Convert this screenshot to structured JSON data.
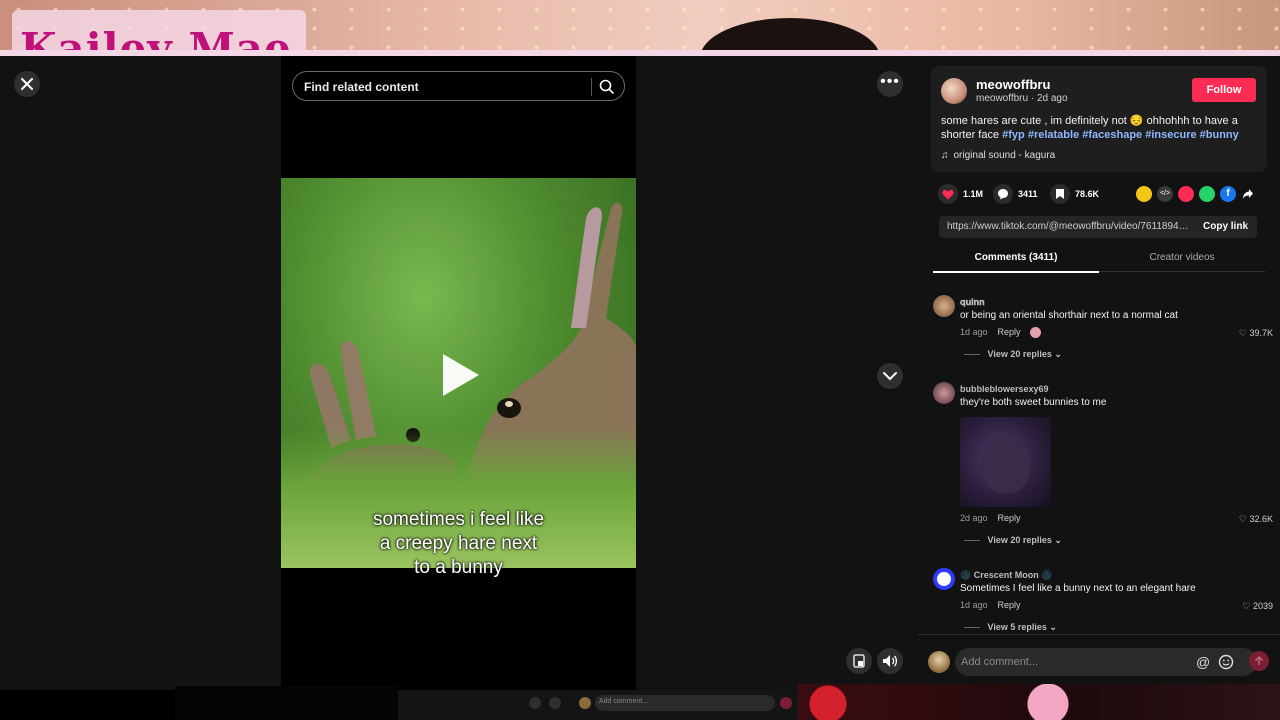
{
  "overlay": {
    "streamer_name": "Kailey Mae"
  },
  "search": {
    "placeholder": "Find related content"
  },
  "video": {
    "caption_lines": [
      "sometimes i feel like",
      "a creepy hare next",
      "to a bunny"
    ]
  },
  "author": {
    "username": "meowoffbru",
    "subline": "meowoffbru · 2d ago",
    "follow_label": "Follow",
    "description": "some hares are cute , im definitely not 😔 ohhohhh to have a shorter face",
    "hashtags": "#fyp #relatable #faceshape #insecure #bunny",
    "sound": "original sound - kagura"
  },
  "stats": {
    "likes": "1.1M",
    "comments": "3411",
    "saves": "78.6K"
  },
  "share_colors": [
    "#f5c518",
    "#3a3a3a",
    "#fe2c55",
    "#25d366",
    "#1877f2"
  ],
  "link": {
    "url": "https://www.tiktok.com/@meowoffbru/video/76118944...",
    "copy_label": "Copy link"
  },
  "tabs": {
    "comments": "Comments (3411)",
    "creator": "Creator videos"
  },
  "comments": [
    {
      "user": "𝐪𝐮𝐢𝐧𝐧",
      "text": "or being an oriental shorthair next to a normal cat",
      "time": "1d ago",
      "reply": "Reply",
      "likes": "39.7K",
      "replies": "View 20 replies"
    },
    {
      "user": "bubbleblowersexy69",
      "text": "they're both sweet bunnies to me",
      "time": "2d ago",
      "reply": "Reply",
      "likes": "32.6K",
      "replies": "View 20 replies"
    },
    {
      "user": "🌑 Crescent Moon 🌑",
      "text": "Sometimes I feel like a bunny next to an elegant hare",
      "time": "1d ago",
      "reply": "Reply",
      "likes": "2039",
      "replies": "View 5 replies"
    }
  ],
  "composer": {
    "placeholder": "Add comment...",
    "at": "@"
  },
  "mini_composer": {
    "placeholder": "Add comment..."
  }
}
